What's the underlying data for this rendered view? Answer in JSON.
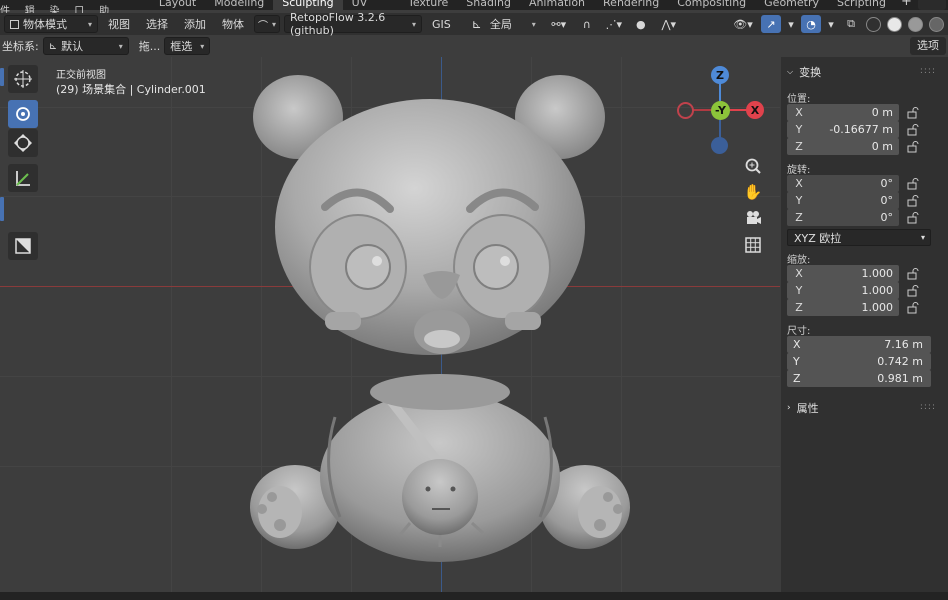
{
  "menu": [
    "文件",
    "编辑",
    "渲染",
    "窗口",
    "帮助"
  ],
  "workspace_tabs": [
    "Layout",
    "Modeling",
    "Sculpting",
    "UV Editing",
    "Texture Paint",
    "Shading",
    "Animation",
    "Rendering",
    "Compositing",
    "Geometry Nodes",
    "Scripting"
  ],
  "active_tab": "Sculpting",
  "header": {
    "mode": "物体模式",
    "view": "视图",
    "select": "选择",
    "add": "添加",
    "object": "物体",
    "addon": "RetopoFlow 3.2.6 (github)",
    "gis": "GIS",
    "pivot": "全局"
  },
  "header2": {
    "orientation_label": "坐标系:",
    "orientation": "默认",
    "drag_label": "拖...",
    "drag_value": "框选",
    "select_button": "选项"
  },
  "viewport": {
    "view_name": "正交前视图",
    "collection": "(29) 场景集合 | Cylinder.001"
  },
  "gizmo": {
    "z": "Z",
    "y": "-Y",
    "x": "X"
  },
  "colors": {
    "accent": "#4772b3",
    "x_axis": "#e0424c",
    "y_axis": "#8cc43a",
    "z_axis": "#4e8ad8"
  },
  "sidebar": {
    "transform_title": "变换",
    "location_label": "位置:",
    "location": [
      {
        "k": "X",
        "v": "0 m"
      },
      {
        "k": "Y",
        "v": "-0.16677 m"
      },
      {
        "k": "Z",
        "v": "0 m"
      }
    ],
    "rotation_label": "旋转:",
    "rotation": [
      {
        "k": "X",
        "v": "0°"
      },
      {
        "k": "Y",
        "v": "0°"
      },
      {
        "k": "Z",
        "v": "0°"
      }
    ],
    "rotation_mode": "XYZ 欧拉",
    "scale_label": "缩放:",
    "scale": [
      {
        "k": "X",
        "v": "1.000"
      },
      {
        "k": "Y",
        "v": "1.000"
      },
      {
        "k": "Z",
        "v": "1.000"
      }
    ],
    "dimensions_label": "尺寸:",
    "dimensions": [
      {
        "k": "X",
        "v": "7.16 m"
      },
      {
        "k": "Y",
        "v": "0.742 m"
      },
      {
        "k": "Z",
        "v": "0.981 m"
      }
    ],
    "properties_title": "属性"
  }
}
